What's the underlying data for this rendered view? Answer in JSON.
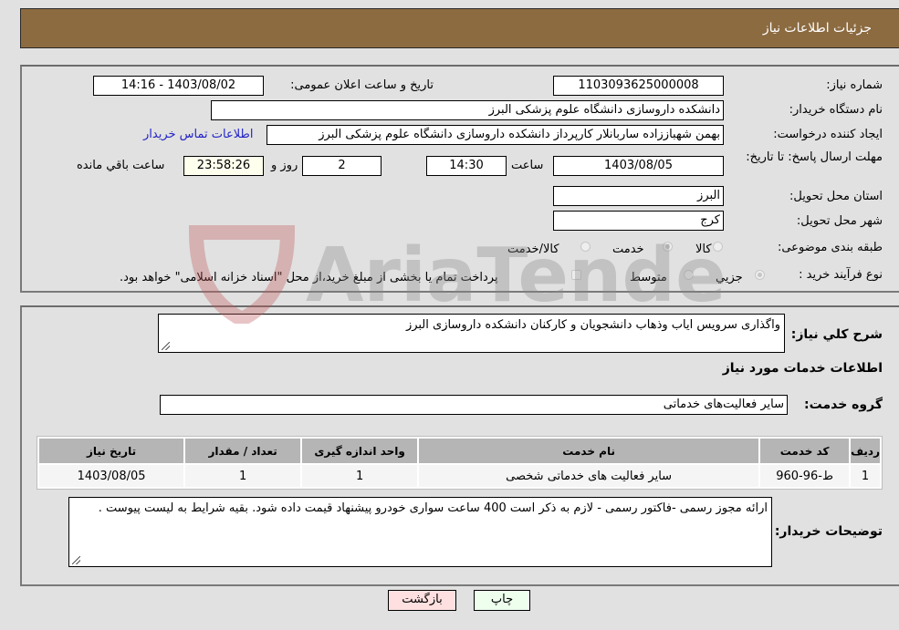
{
  "header": {
    "title": "جزئیات اطلاعات نیاز"
  },
  "info": {
    "need_number_label": "شماره نیاز:",
    "need_number": "1103093625000008",
    "announce_label": "تاریخ و ساعت اعلان عمومی:",
    "announce_value": "1403/08/02 - 14:16",
    "buyer_org_label": "نام دستگاه خریدار:",
    "buyer_org": "دانشکده داروسازی دانشگاه علوم پزشکی البرز",
    "creator_label": "ایجاد کننده درخواست:",
    "creator": "بهمن شهباززاده ساربانلار کارپرداز دانشکده داروسازی دانشگاه علوم پزشکی البرز",
    "contact_link": "اطلاعات تماس خریدار",
    "deadline_label": "مهلت ارسال پاسخ: تا تاریخ:",
    "deadline_date": "1403/08/05",
    "time_label": "ساعت",
    "deadline_time": "14:30",
    "days_value": "2",
    "days_label": "روز و",
    "remaining_time": "23:58:26",
    "remaining_label": "ساعت باقي مانده",
    "province_label": "استان محل تحویل:",
    "province": "البرز",
    "city_label": "شهر محل تحویل:",
    "city": "کرج",
    "category_label": "طبقه بندی موضوعی:",
    "category_options": [
      {
        "label": "کالا",
        "selected": false
      },
      {
        "label": "خدمت",
        "selected": true
      },
      {
        "label": "کالا/خدمت",
        "selected": false
      }
    ],
    "process_label": "نوع فرآیند خرید :",
    "process_options": [
      {
        "label": "جزيي",
        "selected": true
      },
      {
        "label": "متوسط",
        "selected": false
      }
    ],
    "treasury_checkbox_label": "پرداخت تمام یا بخشی از مبلغ خرید،از محل \"اسناد خزانه اسلامی\" خواهد بود."
  },
  "details": {
    "description_label": "شرح کلي نیاز:",
    "description": "واگذاری سرویس ایاب وذهاب دانشجویان و کارکنان دانشکده داروسازی البرز",
    "services_heading": "اطلاعات خدمات مورد نیاز",
    "service_group_label": "گروه خدمت:",
    "service_group": "سایر فعالیت‌های خدماتی",
    "table": {
      "headers": [
        "ردیف",
        "کد خدمت",
        "نام خدمت",
        "واحد اندازه گیری",
        "تعداد / مقدار",
        "تاریخ نیاز"
      ],
      "rows": [
        [
          "1",
          "ط-96-960",
          "سایر فعالیت های خدماتی شخصی",
          "1",
          "1",
          "1403/08/05"
        ]
      ]
    },
    "buyer_notes_label": "توضیحات خریدار:",
    "buyer_notes": "ارائه مجوز رسمی -فاکتور رسمی - لازم به ذکر است 400 ساعت سواری خودرو پیشنهاد قیمت داده شود. بقیه شرایط به لیست پیوست ."
  },
  "buttons": {
    "print": "چاپ",
    "back": "بازگشت"
  },
  "colors": {
    "header_bg": "#8c6b41",
    "print_bg": "#eeffee",
    "back_bg": "#ffe0e0",
    "link": "#2323c8"
  },
  "watermark": {
    "text": "AriaTender.neT"
  }
}
